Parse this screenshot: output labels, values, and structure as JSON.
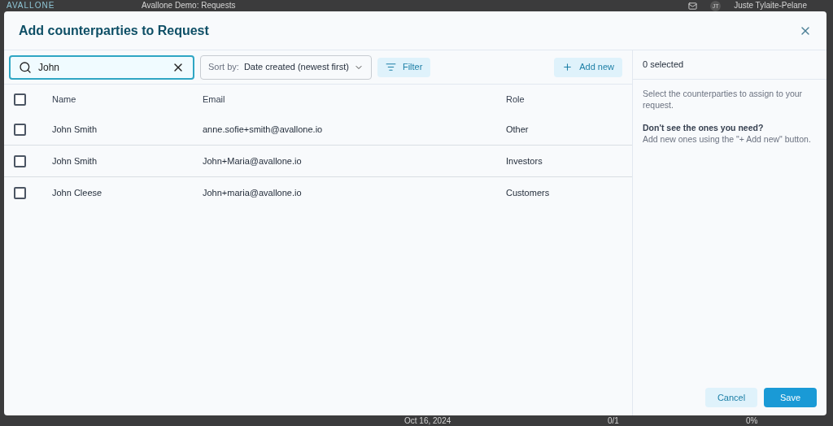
{
  "background": {
    "logo": "AVALLONE",
    "app_name": "Avallone Demo: Requests",
    "user_initials": "JT",
    "user_name": "Juste Tylaite-Pelane",
    "date": "Oct 16, 2024",
    "progress_count": "0/1",
    "percent": "0%"
  },
  "dialog": {
    "title": "Add counterparties to Request"
  },
  "search": {
    "value": "John"
  },
  "sort": {
    "label": "Sort by:",
    "value": "Date created (newest first)"
  },
  "filter_button": "Filter",
  "add_button": "Add new",
  "table": {
    "select_all_checked": false,
    "columns": [
      "Name",
      "Email",
      "Role"
    ],
    "rows": [
      {
        "name": "John Smith",
        "email": "anne.sofie+smith@avallone.io",
        "role": "Other",
        "checked": false
      },
      {
        "name": "John Smith",
        "email": "John+Maria@avallone.io",
        "role": "Investors",
        "checked": false
      },
      {
        "name": "John Cleese",
        "email": "John+maria@avallone.io",
        "role": "Customers",
        "checked": false
      }
    ]
  },
  "selection": {
    "count": "0 selected",
    "hint": "Select the counterparties to assign to your request.",
    "help_title": "Don't see the ones you need?",
    "help_text": "Add new ones using the \"+ Add new\" button."
  },
  "buttons": {
    "cancel": "Cancel",
    "save": "Save"
  }
}
